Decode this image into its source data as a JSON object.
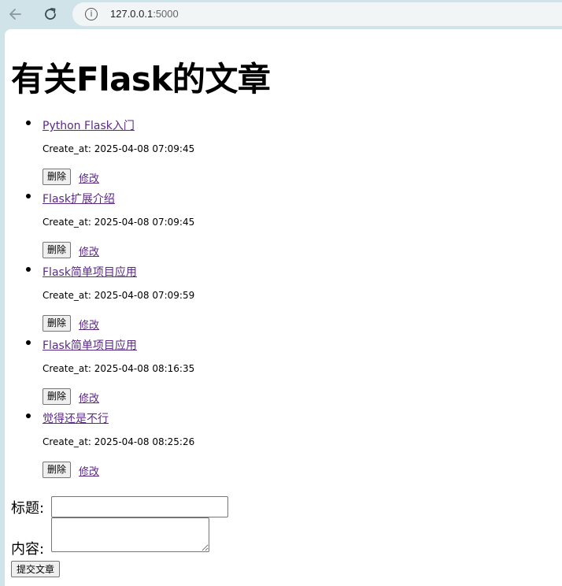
{
  "browser": {
    "url_host": "127.0.0.1",
    "url_port": ":5000",
    "info_symbol": "i"
  },
  "page": {
    "title": "有关Flask的文章",
    "articles": [
      {
        "title": "Python Flask入门",
        "created": "Create_at: 2025-04-08 07:09:45",
        "delete_label": "删除",
        "edit_label": "修改"
      },
      {
        "title": "Flask扩展介绍",
        "created": "Create_at: 2025-04-08 07:09:45",
        "delete_label": "删除",
        "edit_label": "修改"
      },
      {
        "title": "Flask简单项目应用",
        "created": "Create_at: 2025-04-08 07:09:59",
        "delete_label": "删除",
        "edit_label": "修改"
      },
      {
        "title": "Flask简单项目应用",
        "created": "Create_at: 2025-04-08 08:16:35",
        "delete_label": "删除",
        "edit_label": "修改"
      },
      {
        "title": "觉得还是不行",
        "created": "Create_at: 2025-04-08 08:25:26",
        "delete_label": "删除",
        "edit_label": "修改"
      }
    ],
    "form": {
      "title_label": "标题:",
      "title_value": "",
      "content_label": "内容:",
      "content_value": "",
      "submit_label": "提交文章"
    }
  }
}
